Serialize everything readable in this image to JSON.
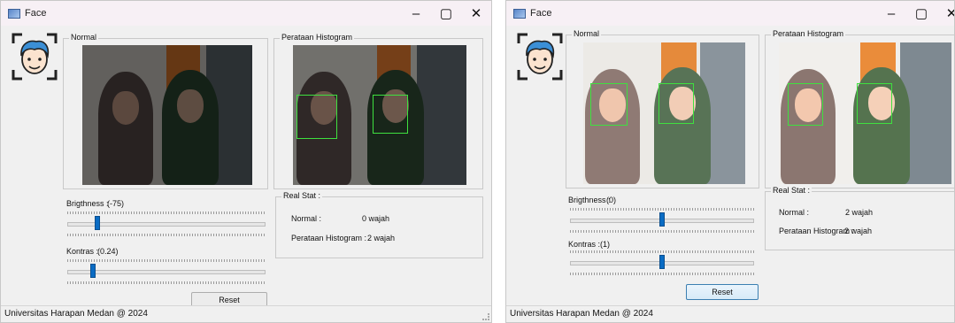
{
  "left_window": {
    "title": "Face",
    "controls": {
      "minimize": "‒",
      "maximize": "▢",
      "close": "✕"
    },
    "normal_group": {
      "label": "Normal"
    },
    "hist_group": {
      "label": "Perataan Histogram"
    },
    "brightness": {
      "label": "Brigthness :",
      "value": "(-75)",
      "level": 0.14
    },
    "contrast": {
      "label": "Kontras :",
      "value": "(0.24)",
      "level": 0.12
    },
    "stats": {
      "label": "Real Stat :",
      "normal_label": "Normal :",
      "normal_value": "0 wajah",
      "hist_label": "Perataan Histogram :",
      "hist_value": "2 wajah"
    },
    "reset_label": "Reset",
    "status": "Universitas Harapan Medan @ 2024"
  },
  "right_window": {
    "title": "Face",
    "controls": {
      "minimize": "‒",
      "maximize": "▢",
      "close": "✕"
    },
    "normal_group": {
      "label": "Normal"
    },
    "hist_group": {
      "label": "Perataan Histogram"
    },
    "brightness": {
      "label": "Brigthness :",
      "value": "(0)",
      "level": 0.5
    },
    "contrast": {
      "label": "Kontras :",
      "value": "(1)",
      "level": 0.5
    },
    "stats": {
      "label": "Real Stat :",
      "normal_label": "Normal :",
      "normal_value": "2 wajah",
      "hist_label": "Perataan Histogram :",
      "hist_value": "2 wajah"
    },
    "reset_label": "Reset",
    "status": "Universitas Harapan Medan @ 2024"
  },
  "colors": {
    "face_box": "#3fe03f",
    "slider_thumb": "#0a6cc4",
    "titlebar": "#f7f0f5"
  }
}
